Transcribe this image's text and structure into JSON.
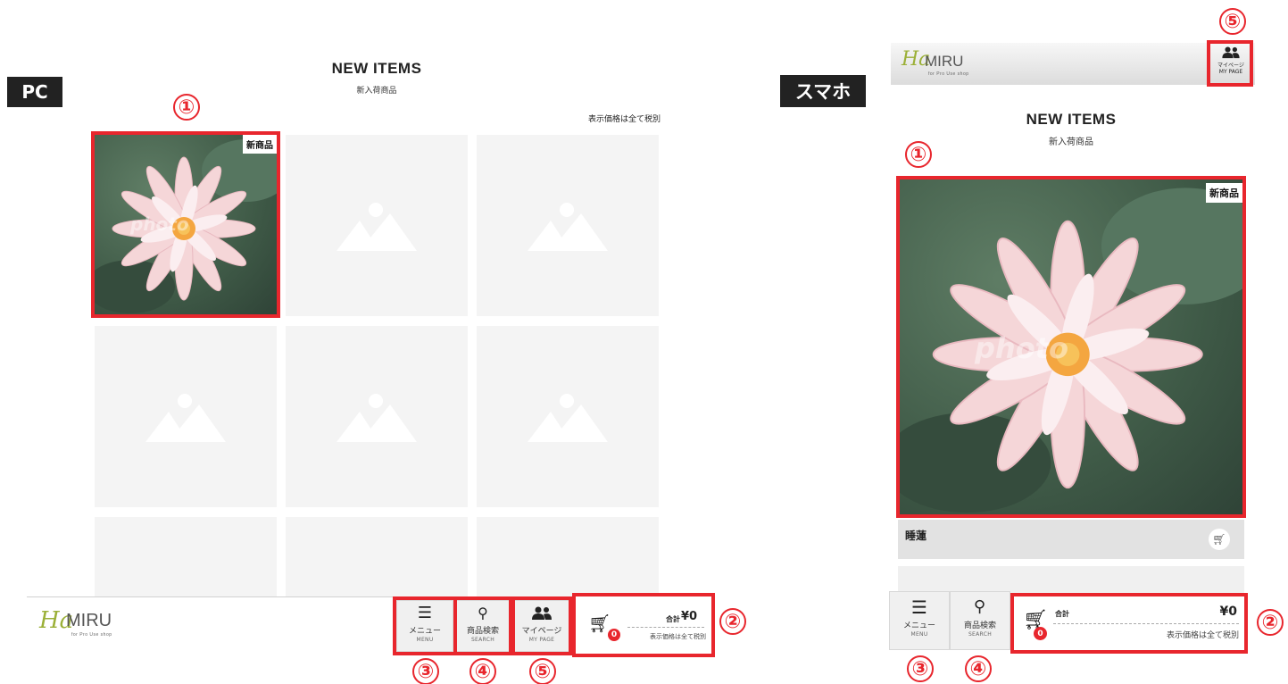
{
  "pc": {
    "tag": "PC",
    "title": "NEW ITEMS",
    "subtitle": "新入荷商品",
    "tax_note": "表示価格は全て税別",
    "badge": "新商品",
    "watermark": "photo",
    "logo": {
      "script": "Ha",
      "text": "MIRU",
      "caption": "for Pro Use shop"
    },
    "menu": {
      "label": "メニュー",
      "en": "MENU"
    },
    "search": {
      "label": "商品検索",
      "en": "SEARCH"
    },
    "mypage": {
      "label": "マイページ",
      "en": "MY PAGE"
    },
    "cart": {
      "count": "0",
      "total_label": "合計",
      "total": "¥0",
      "tax_note": "表示価格は全て税別"
    },
    "markers": {
      "item": "①",
      "cart": "②",
      "menu": "③",
      "search": "④",
      "mypage": "⑤"
    }
  },
  "sp": {
    "tag": "スマホ",
    "title": "NEW ITEMS",
    "subtitle": "新入荷商品",
    "badge": "新商品",
    "watermark": "photo",
    "product_name": "睡蓮",
    "logo": {
      "script": "Ha",
      "text": "MIRU",
      "caption": "for Pro Use shop"
    },
    "menu": {
      "label": "メニュー",
      "en": "MENU"
    },
    "search": {
      "label": "商品検索",
      "en": "SEARCH"
    },
    "mypage": {
      "label": "マイページ",
      "en": "MY PAGE"
    },
    "cart": {
      "count": "0",
      "total_label": "合計",
      "total": "¥0",
      "tax_note": "表示価格は全て税別"
    },
    "markers": {
      "item": "①",
      "cart": "②",
      "menu": "③",
      "search": "④",
      "mypage": "⑤"
    }
  },
  "colors": {
    "accent_red": "#e8262d",
    "logo_green": "#9bb038",
    "placeholder": "#f4f4f4"
  }
}
